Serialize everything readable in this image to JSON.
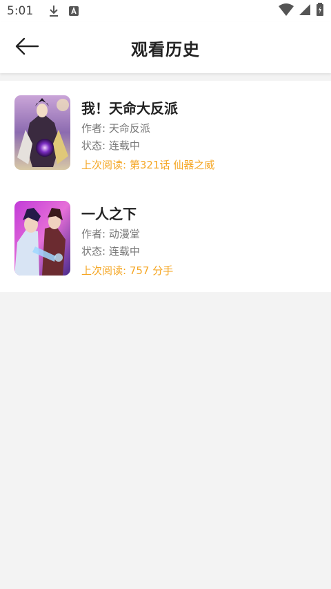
{
  "status_bar": {
    "time": "5:01",
    "icons": [
      "download-icon",
      "a-notification-icon",
      "wifi-icon",
      "signal-icon",
      "battery-icon"
    ]
  },
  "header": {
    "title": "观看历史",
    "back_icon": "back-arrow-icon"
  },
  "history": [
    {
      "title": "我！天命大反派",
      "author": "作者: 天命反派",
      "status": "状态: 连载中",
      "last_read": "上次阅读: 第321话 仙器之威"
    },
    {
      "title": "一人之下",
      "author": "作者: 动漫堂",
      "status": "状态: 连载中",
      "last_read": "上次阅读: 757 分手"
    }
  ],
  "colors": {
    "accent": "#f5a623",
    "background": "#f3f3f3",
    "card": "#ffffff"
  }
}
